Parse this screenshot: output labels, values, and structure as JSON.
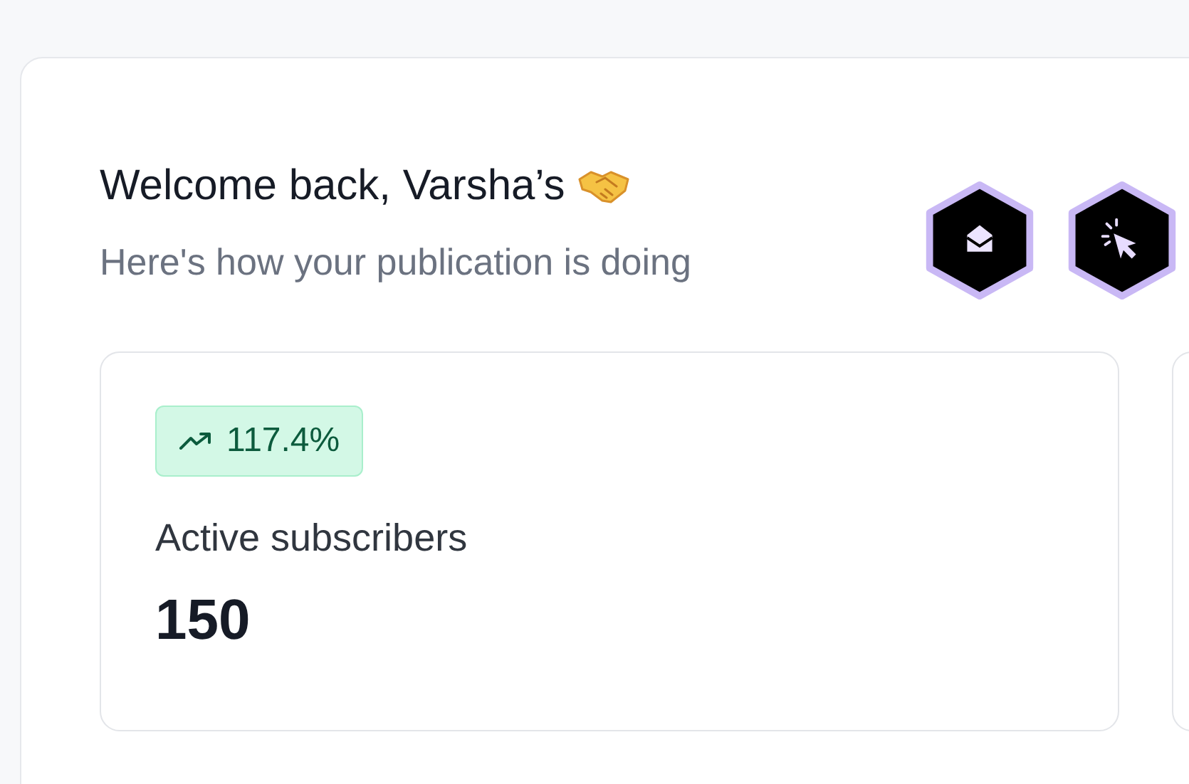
{
  "header": {
    "title": "Welcome back, Varsha’s",
    "subtitle": "Here's how your publication is doing"
  },
  "stats": [
    {
      "change": "117.4%",
      "positive": true,
      "label": "Active subscribers",
      "value": "150"
    }
  ]
}
